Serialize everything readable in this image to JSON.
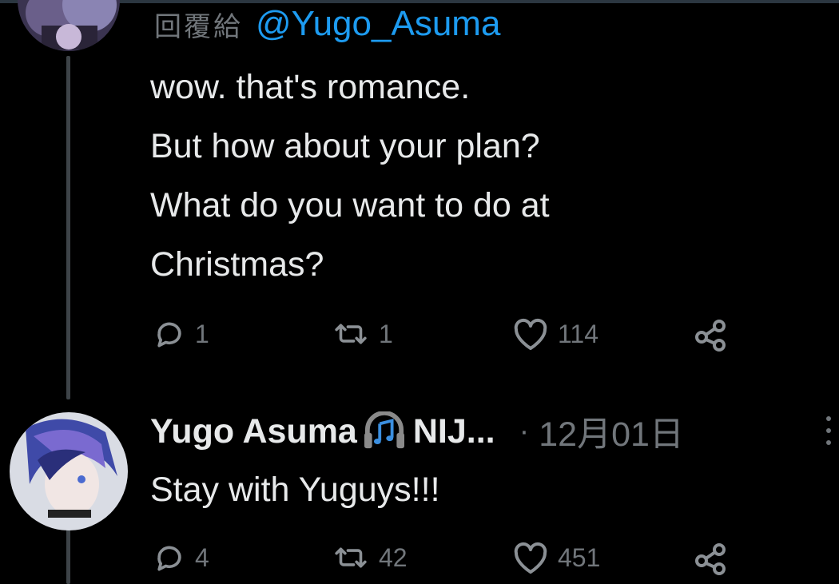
{
  "thread": {
    "first_tweet": {
      "reply_prefix": "回覆給",
      "reply_handle": "@Yugo_Asuma",
      "text_lines": [
        "wow. that's romance.",
        "But how about your plan?",
        "What do you want to do at",
        "Christmas?"
      ],
      "actions": {
        "reply_count": "1",
        "retweet_count": "1",
        "like_count": "114"
      }
    },
    "second_tweet": {
      "author_name": "Yugo Asuma",
      "author_badge_icon": "headphone-music-icon",
      "author_suffix": "NIJ...",
      "separator": "·",
      "timestamp": "12月01日",
      "text_lines": [
        "Stay with Yuguys!!!"
      ],
      "actions": {
        "reply_count": "4",
        "retweet_count": "42",
        "like_count": "451"
      }
    }
  },
  "colors": {
    "background": "#000000",
    "text_primary": "#e7e9ea",
    "text_secondary": "#71767b",
    "link": "#1d9bf0",
    "thread_line": "#3d4348"
  }
}
